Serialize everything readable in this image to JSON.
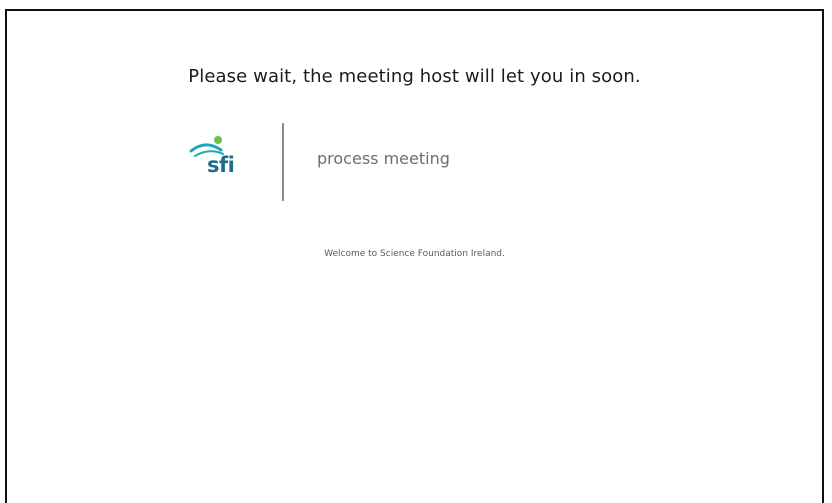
{
  "lobby": {
    "wait_message": "Please wait, the meeting host will let you in soon.",
    "logo_text": "sfi",
    "meeting_name": "process meeting",
    "welcome_message": "Welcome to Science Foundation Ireland."
  },
  "colors": {
    "logo_blue": "#1f6c8c",
    "logo_teal": "#1aa7b8",
    "logo_green": "#6cc04a"
  }
}
